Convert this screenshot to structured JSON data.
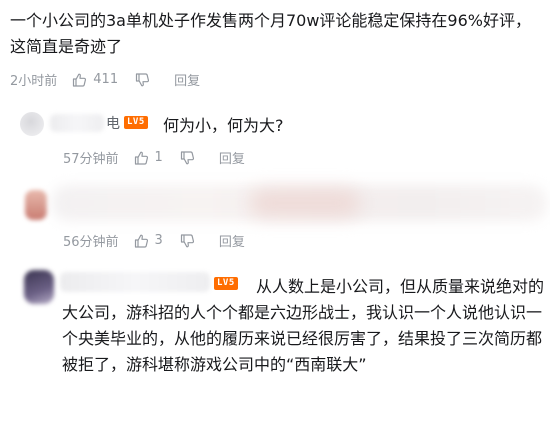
{
  "main_comment": {
    "text": "一个小公司的3a单机处子作发售两个月70w评论能稳定保持在96%好评，这简直是奇迹了",
    "time": "2小时前",
    "like_count": "411",
    "reply_label": "回复"
  },
  "replies": [
    {
      "username_visible": "电",
      "level_badge": "LV5",
      "content": "何为小，何为大?",
      "time": "57分钟前",
      "like_count": "1",
      "reply_label": "回复"
    },
    {
      "time": "56分钟前",
      "like_count": "3",
      "reply_label": "回复"
    },
    {
      "level_badge": "LV5",
      "content": "从人数上是小公司，但从质量来说绝对的大公司，游科招的人个个都是六边形战士，我认识一个人说他认识一个央美毕业的，从他的履历来说已经很厉害了，结果投了三次简历都被拒了，游科堪称游戏公司中的“西南联大”"
    }
  ],
  "icons": [
    "thumb-up-icon",
    "thumb-down-icon"
  ],
  "colors": {
    "meta_text": "#9499a0",
    "level_badge": "#ff6d00",
    "text": "#18191c"
  }
}
